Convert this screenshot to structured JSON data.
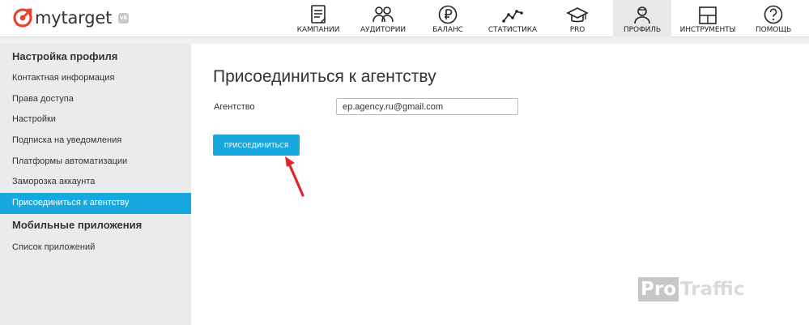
{
  "brand": {
    "name": "mytarget",
    "vk_badge": "vk",
    "accent": "#e8442e"
  },
  "nav": {
    "items": [
      {
        "label": "КАМПАНИИ",
        "icon": "document-icon"
      },
      {
        "label": "АУДИТОРИИ",
        "icon": "people-icon"
      },
      {
        "label": "БАЛАНС",
        "icon": "ruble-icon"
      },
      {
        "label": "СТАТИСТИКА",
        "icon": "line-chart-icon"
      },
      {
        "label": "PRO",
        "icon": "graduation-cap-icon"
      },
      {
        "label": "ПРОФИЛЬ",
        "icon": "user-icon",
        "active": true
      },
      {
        "label": "ИНСТРУМЕНТЫ",
        "icon": "tools-icon"
      },
      {
        "label": "ПОМОЩЬ",
        "icon": "question-icon"
      }
    ]
  },
  "sidebar": {
    "profile_section": "Настройка профиля",
    "items": [
      "Контактная информация",
      "Права доступа",
      "Настройки",
      "Подписка на уведомления",
      "Платформы автоматизации",
      "Заморозка аккаунта",
      "Присоединиться к агентству"
    ],
    "apps_section": "Мобильные приложения",
    "apps_items": [
      "Список приложений"
    ]
  },
  "main": {
    "title": "Присоединиться к агентству",
    "agency_label": "Агентство",
    "agency_value": "ep.agency.ru@gmail.com",
    "join_button": "Присоединиться"
  },
  "watermark": {
    "box": "Pro",
    "text": "Traffic"
  },
  "colors": {
    "primary": "#18a8e0",
    "arrow": "#e0242a"
  }
}
